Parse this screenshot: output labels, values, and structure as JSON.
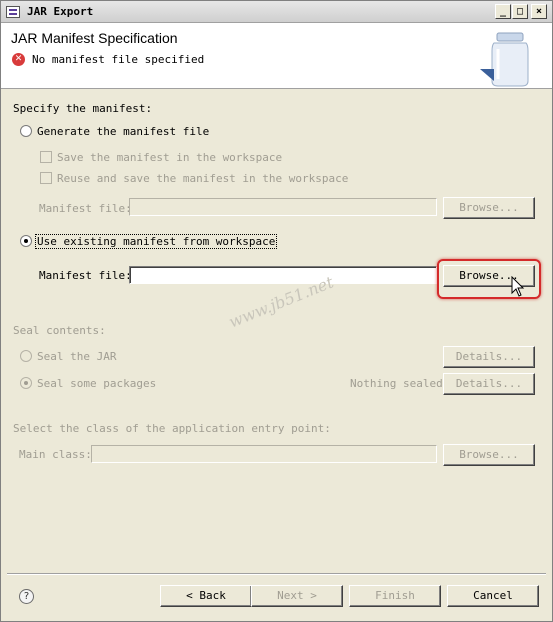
{
  "window": {
    "title": "JAR Export",
    "buttons": {
      "minimize": "_",
      "maximize": "□",
      "close": "×"
    }
  },
  "header": {
    "title": "JAR Manifest Specification",
    "error_message": "No manifest file specified",
    "error_icon": "error-icon"
  },
  "manifest": {
    "section_label": "Specify the manifest:",
    "generate_label": "Generate the manifest file",
    "save_in_workspace_label": "Save the manifest in the workspace",
    "reuse_label": "Reuse and save the manifest in the workspace",
    "manifest_file_label_1": "Manifest file:",
    "browse_1": "Browse...",
    "use_existing_label": "Use existing manifest from workspace",
    "manifest_file_label_2": "Manifest file:",
    "manifest_file_value": "",
    "browse_2": "Browse..."
  },
  "seal": {
    "section_label": "Seal contents:",
    "seal_jar_label": "Seal the JAR",
    "details_1": "Details...",
    "seal_packages_label": "Seal some packages",
    "nothing_sealed": "Nothing sealed",
    "details_2": "Details..."
  },
  "entry_point": {
    "section_label": "Select the class of the application entry point:",
    "main_class_label": "Main class:",
    "main_class_value": "",
    "browse": "Browse..."
  },
  "watermark": "www.jb51.net",
  "footer": {
    "help_icon": "?",
    "back": "< Back",
    "next": "Next >",
    "finish": "Finish",
    "cancel": "Cancel"
  },
  "colors": {
    "highlight": "#d42a2a",
    "error": "#d83b3b",
    "disabled_text": "#a09d92"
  }
}
